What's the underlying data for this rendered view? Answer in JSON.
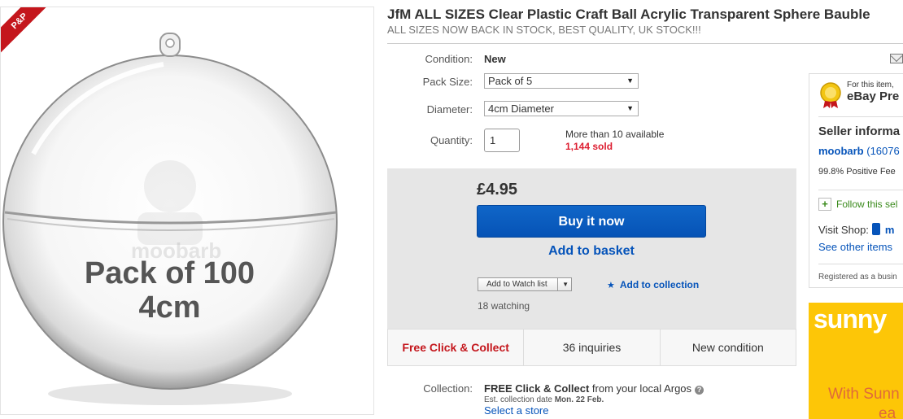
{
  "image": {
    "ribbon": "P&P",
    "pack_line1": "Pack of 100",
    "pack_line2": "4cm",
    "watermark": "moobarb"
  },
  "listing": {
    "title": "JfM ALL SIZES Clear Plastic Craft Ball Acrylic Transparent Sphere Bauble",
    "subtitle": "ALL SIZES NOW BACK IN STOCK, BEST QUALITY, UK STOCK!!!"
  },
  "form": {
    "condition_label": "Condition:",
    "condition_value": "New",
    "pack_size_label": "Pack Size:",
    "pack_size_value": "Pack of 5",
    "diameter_label": "Diameter:",
    "diameter_value": "4cm Diameter",
    "quantity_label": "Quantity:",
    "quantity_value": "1",
    "available": "More than 10 available",
    "sold": "1,144 sold"
  },
  "buy": {
    "price": "£4.95",
    "buy_now": "Buy it now",
    "add_to_basket": "Add to basket",
    "watch_list": "Add to Watch list",
    "add_to_collection": "Add to collection",
    "watching": "18 watching"
  },
  "features": [
    "Free Click & Collect",
    "36 inquiries",
    "New condition"
  ],
  "collection": {
    "label": "Collection:",
    "free_prefix": "FREE Click & Collect",
    "free_suffix": " from your local Argos",
    "date_prefix": "Est. collection date ",
    "date_value": "Mon. 22 Feb.",
    "select_store": "Select a store"
  },
  "seller": {
    "for_this": "For this item,",
    "premium": "eBay Pre",
    "info_title": "Seller informa",
    "name": "moobarb",
    "score": " (16076",
    "positive": "99.8% Positive Fee",
    "follow": "Follow this sel",
    "visit_shop": "Visit Shop:",
    "shop_initial": "m",
    "see_other": "See other items",
    "registered": "Registered as a busin"
  },
  "ad": {
    "logo": "sunny",
    "text1": "With Sunn",
    "text2": "ea"
  },
  "colors": {
    "link": "#0654ba",
    "buy_button": "#0654ba",
    "sold_red": "#dd1e31",
    "ad_yellow": "#fdc607"
  }
}
